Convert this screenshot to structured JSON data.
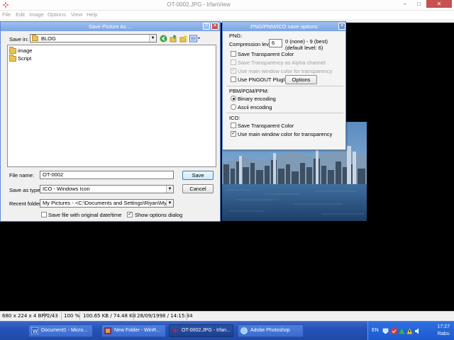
{
  "main_window": {
    "title": "OT-0002.JPG - IrfanView",
    "controls": {
      "minimize": "–",
      "maximize": "□",
      "close": "✕"
    },
    "menu": [
      "File",
      "Edit",
      "Image",
      "Options",
      "View",
      "Help"
    ]
  },
  "status_bar": {
    "dimensions": "680 x 224 x 4 BPP",
    "index": "2/43",
    "zoom": "100 %",
    "size": "100.65 KB / 74.48 KB",
    "datetime": "28/09/1998 / 14:15:34"
  },
  "save_dialog": {
    "title": "Save Picture As ...",
    "help_label": "?",
    "close_label": "✕",
    "save_in_label": "Save in:",
    "save_in_value": "BLOG",
    "files": [
      "image",
      "Script"
    ],
    "file_name_label": "File name:",
    "file_name_value": "OT-0002",
    "save_type_label": "Save as type:",
    "save_type_value": "ICO - Windows Icon",
    "recent_label": "Recent folders:",
    "recent_value": "My Pictures  -  <C:\\Documents and Settings\\Riyan\\My Docu",
    "save_button": "Save",
    "cancel_button": "Cancel",
    "keep_date_label": "Save file with original date/time",
    "keep_date_checked": false,
    "show_options_label": "Show options dialog",
    "show_options_checked": true
  },
  "options_dialog": {
    "title": "PNG/PNM/ICO save options",
    "close_label": "✕",
    "png_section": "PNG:",
    "compression_label": "Compression level:",
    "compression_value": "6",
    "compression_hint_1": "0 (none) - 9 (best)",
    "compression_hint_2": "(default level: 6)",
    "png_transparent_label": "Save Transparent Color",
    "png_alpha_label": "Save Transparency as Alpha channel",
    "png_mainwin_label": "Use main window color for transparency",
    "pngout_label": "Use PNGOUT PlugIn",
    "options_button": "Options",
    "pbm_section": "PBM/PGM/PPM:",
    "binary_label": "Binary encoding",
    "ascii_label": "Ascii encoding",
    "binary_selected": true,
    "ico_section": "ICO:",
    "ico_transparent_label": "Save Transparent Color",
    "ico_mainwin_label": "Use main window color for transparency",
    "ico_transparent_checked": false,
    "ico_mainwin_checked": true
  },
  "taskbar": {
    "tasks": [
      {
        "label": "Document1 - Micro...",
        "active": false
      },
      {
        "label": "New Folder - WinR...",
        "active": false
      },
      {
        "label": "OT-0002.JPG - Irfan...",
        "active": true
      },
      {
        "label": "Adobe Photoshop",
        "active": false
      }
    ],
    "language": "EN",
    "time": "17:27",
    "day": "Rabu"
  },
  "colors": {
    "canvas": "#000000",
    "dialog_title": "#7aa4e4",
    "taskbar": "#2452b7",
    "close_button": "#c75050"
  }
}
